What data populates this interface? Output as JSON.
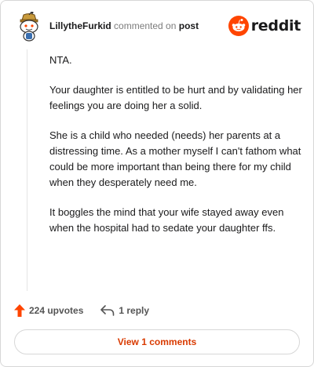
{
  "post": {
    "username": "LillytheFurkid",
    "action_text": "commented on",
    "target_text": "post",
    "brand": "reddit"
  },
  "comment": {
    "paragraphs": [
      "NTA.",
      "Your daughter is entitled to be hurt and by validating her feelings you are doing her a solid.",
      "She is a child who needed (needs) her parents at a distressing time. As a mother myself I can't fathom what could be more important than being there for my child when they desperately need me.",
      "It boggles the mind that your wife stayed away even when the hospital had to sedate your daughter ffs."
    ]
  },
  "actions": {
    "upvotes_label": "224 upvotes",
    "reply_label": "1 reply"
  },
  "footer": {
    "view_comments_label": "View 1 comments"
  },
  "colors": {
    "accent": "#ff4500",
    "link": "#d93a00",
    "muted": "#7c7c7c"
  },
  "icons": {
    "avatar": "snoo-avatar",
    "brand": "reddit-logo-icon",
    "upvote": "upvote-arrow-icon",
    "reply": "reply-arrow-icon"
  }
}
